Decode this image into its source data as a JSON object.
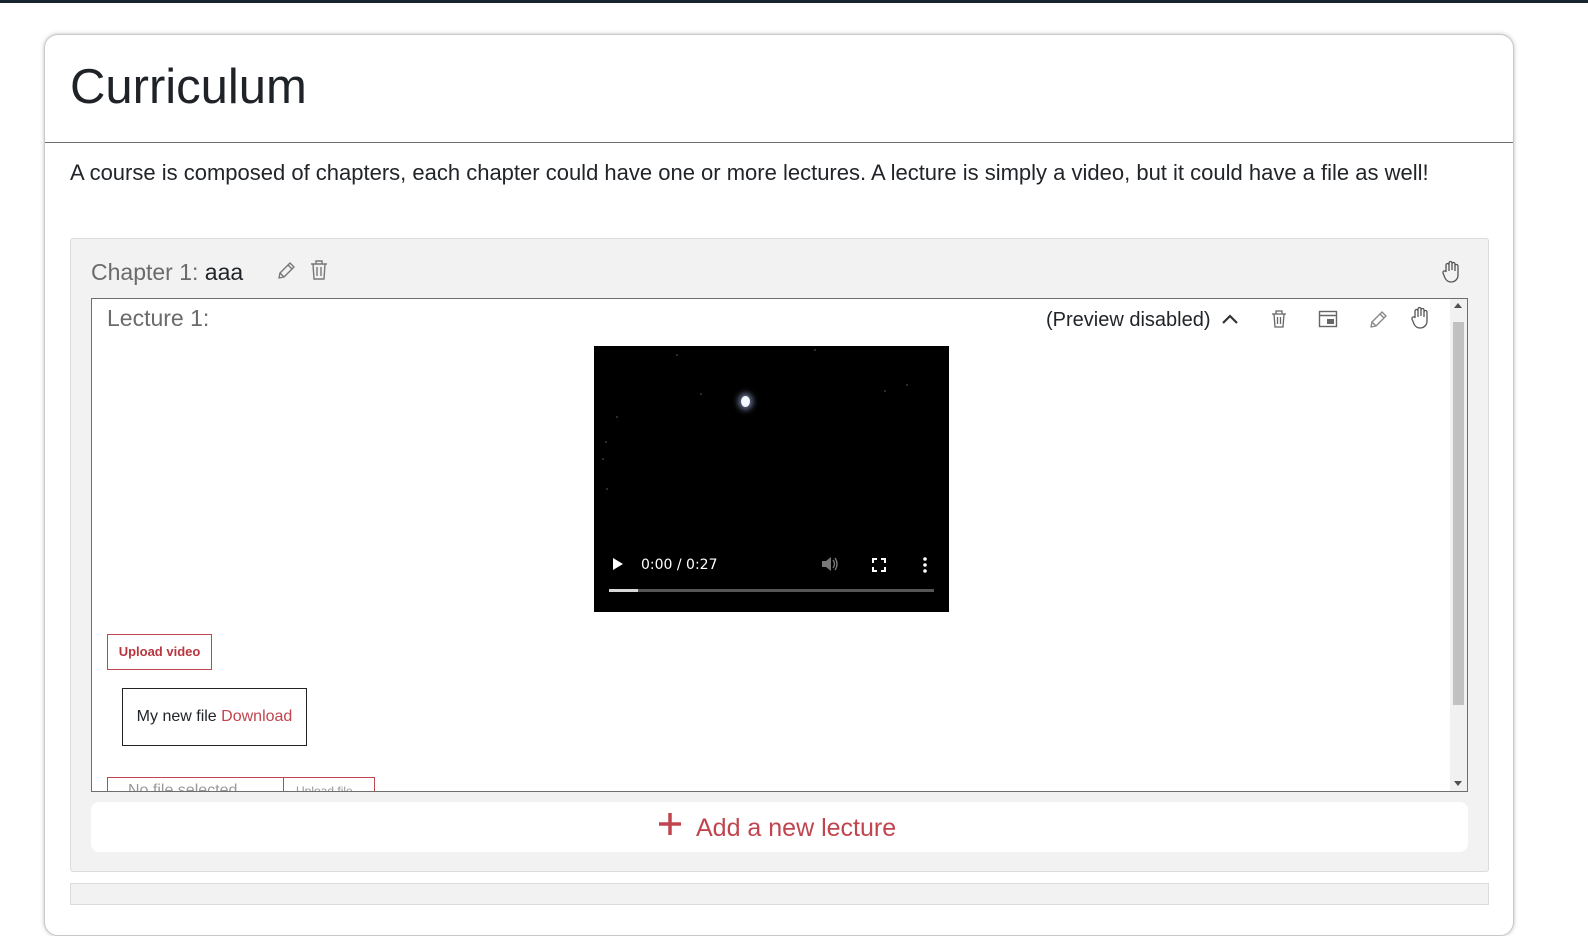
{
  "page": {
    "title": "Curriculum",
    "description": "A course is composed of chapters, each chapter could have one or more lectures. A lecture is simply a video, but it could have a file as well!"
  },
  "chapter": {
    "prefix": "Chapter 1:",
    "name": "aaa",
    "icons": [
      "pencil-icon",
      "trash-icon",
      "hand-drag-icon"
    ]
  },
  "lecture": {
    "title": "Lecture 1:",
    "preview_label": "(Preview disabled)",
    "icons": [
      "chevron-up-icon",
      "trash-icon",
      "window-icon",
      "pencil-icon",
      "hand-drag-icon"
    ],
    "video": {
      "time": "0:00 / 0:27",
      "progress": 0.09,
      "controls": [
        "play-icon",
        "volume-icon",
        "fullscreen-icon",
        "more-icon"
      ]
    },
    "upload_video_label": "Upload video",
    "file": {
      "name": "My new file",
      "download_label": "Download"
    },
    "file_input_placeholder": "No file selected",
    "upload_file_label": "Upload file"
  },
  "add_lecture_label": "Add a new lecture",
  "colors": {
    "accent": "#c0454e",
    "panel": "#f2f2f2",
    "topbar": "#1a2330"
  }
}
